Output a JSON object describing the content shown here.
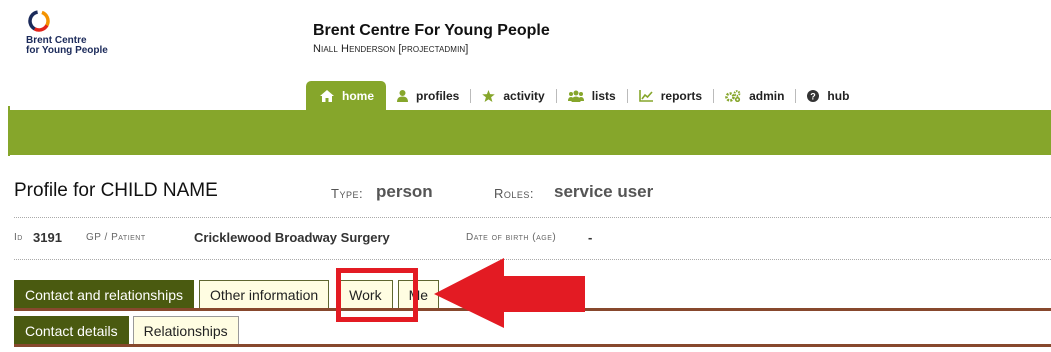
{
  "logo": {
    "line1": "Brent Centre",
    "line2": "for Young People"
  },
  "header": {
    "org_name": "Brent Centre For Young People",
    "user": "Niall Henderson [projectadmin]"
  },
  "nav": {
    "home": "home",
    "profiles": "profiles",
    "activity": "activity",
    "lists": "lists",
    "reports": "reports",
    "admin": "admin",
    "hub": "hub"
  },
  "profile": {
    "title": "Profile for CHILD NAME",
    "type_label": "Type:",
    "type_value": "person",
    "roles_label": "Roles:",
    "roles_value": "service user",
    "id_label": "Id",
    "id_value": "3191",
    "gp_label": "GP / Patient",
    "gp_value": "Cricklewood Broadway Surgery",
    "dob_label": "Date of birth (age)",
    "dob_value": "-"
  },
  "tabs": [
    "Contact and relationships",
    "Other information",
    "Work",
    "Me"
  ],
  "subtabs": [
    "Contact details",
    "Relationships"
  ],
  "colors": {
    "nav_green": "#86a62b",
    "tab_active": "#4a5a10",
    "tab_inactive": "#fffde2",
    "tab_rule": "#87482d",
    "annotation_red": "#e31b23"
  },
  "icons": {
    "home": "home-icon",
    "profiles": "user-icon",
    "activity": "star-icon",
    "lists": "users-icon",
    "reports": "line-chart-icon",
    "admin": "cogs-icon",
    "hub": "question-circle-icon"
  }
}
